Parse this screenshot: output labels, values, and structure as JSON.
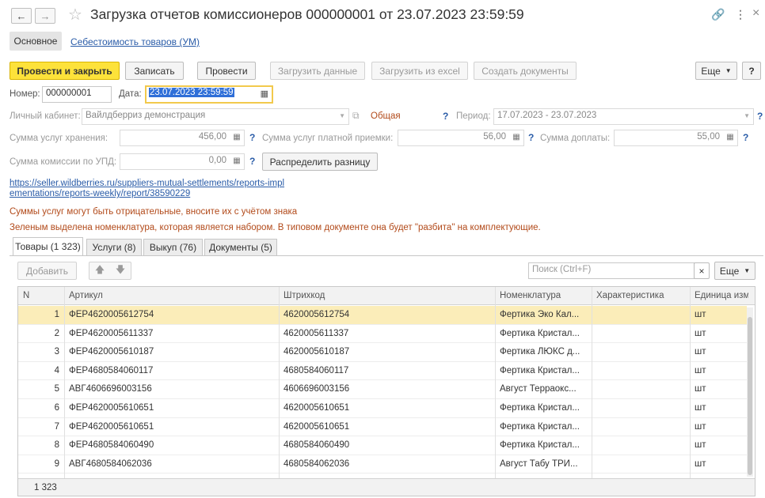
{
  "window": {
    "title": "Загрузка отчетов комиссионеров 000000001 от 23.07.2023 23:59:59"
  },
  "sections": {
    "main": "Основное",
    "cost": "Себестоимость товаров (УМ)"
  },
  "toolbar": {
    "post_close": "Провести и закрыть",
    "save": "Записать",
    "post": "Провести",
    "load_data": "Загрузить данные",
    "load_excel": "Загрузить из excel",
    "create_docs": "Создать документы",
    "more": "Еще",
    "help": "?"
  },
  "header": {
    "number_label": "Номер:",
    "number_value": "000000001",
    "date_label": "Дата:",
    "date_value": "23.07.2023 23:59:59",
    "cabinet_label": "Личный кабинет:",
    "cabinet_value": "Вайлдберриз демонстрация",
    "general_label": "Общая",
    "period_label": "Период:",
    "period_value": "17.07.2023 - 23.07.2023",
    "storage_label": "Сумма услуг хранения:",
    "storage_value": "456,00",
    "paid_accept_label": "Сумма услуг платной приемки:",
    "paid_accept_value": "56,00",
    "surcharge_label": "Сумма доплаты:",
    "surcharge_value": "55,00",
    "commission_label": "Сумма комиссии по УПД:",
    "commission_value": "0,00",
    "distribute_button": "Распределить разницу",
    "report_link_1": "https://seller.wildberries.ru/suppliers-mutual-settlements/reports-impl",
    "report_link_2": "ementations/reports-weekly/report/38590229",
    "note_1": "Суммы услуг могут быть отрицательные, вносите их  с учётом знака",
    "note_2": "Зеленым выделена номенклатура, которая является набором. В типовом документе она будет \"разбита\" на комплектующие."
  },
  "tabs": [
    {
      "label": "Товары (1 323)"
    },
    {
      "label": "Услуги (8)"
    },
    {
      "label": "Выкуп (76)"
    },
    {
      "label": "Документы (5)"
    }
  ],
  "table_toolbar": {
    "add": "Добавить",
    "search_placeholder": "Поиск (Ctrl+F)",
    "clear": "×",
    "more": "Еще"
  },
  "table": {
    "columns": [
      "N",
      "Артикул",
      "Штрихкод",
      "Номенклатура",
      "Характеристика",
      "Единица изм"
    ],
    "rows": [
      {
        "n": "1",
        "article": "ФЕР4620005612754",
        "barcode": "4620005612754",
        "nomenclature": "Фертика Эко Кал...",
        "char": "",
        "unit": "шт"
      },
      {
        "n": "2",
        "article": "ФЕР4620005611337",
        "barcode": "4620005611337",
        "nomenclature": "Фертика Кристал...",
        "char": "",
        "unit": "шт"
      },
      {
        "n": "3",
        "article": "ФЕР4620005610187",
        "barcode": "4620005610187",
        "nomenclature": "Фертика ЛЮКС д...",
        "char": "",
        "unit": "шт"
      },
      {
        "n": "4",
        "article": "ФЕР4680584060117",
        "barcode": "4680584060117",
        "nomenclature": "Фертика Кристал...",
        "char": "",
        "unit": "шт"
      },
      {
        "n": "5",
        "article": "АВГ4606696003156",
        "barcode": "4606696003156",
        "nomenclature": "Август Терраокс...",
        "char": "",
        "unit": "шт"
      },
      {
        "n": "6",
        "article": "ФЕР4620005610651",
        "barcode": "4620005610651",
        "nomenclature": "Фертика Кристал...",
        "char": "",
        "unit": "шт"
      },
      {
        "n": "7",
        "article": "ФЕР4620005610651",
        "barcode": "4620005610651",
        "nomenclature": "Фертика Кристал...",
        "char": "",
        "unit": "шт"
      },
      {
        "n": "8",
        "article": "ФЕР4680584060490",
        "barcode": "4680584060490",
        "nomenclature": "Фертика Кристал...",
        "char": "",
        "unit": "шт"
      },
      {
        "n": "9",
        "article": "АВГ4680584062036",
        "barcode": "4680584062036",
        "nomenclature": "Август Табу ТРИ...",
        "char": "",
        "unit": "шт"
      }
    ],
    "footer_count": "1 323"
  },
  "colors": {
    "primary_button": "#fde23a",
    "selected_row": "#fbedb9",
    "link": "#2a5ca8",
    "note": "#b24a1a"
  }
}
